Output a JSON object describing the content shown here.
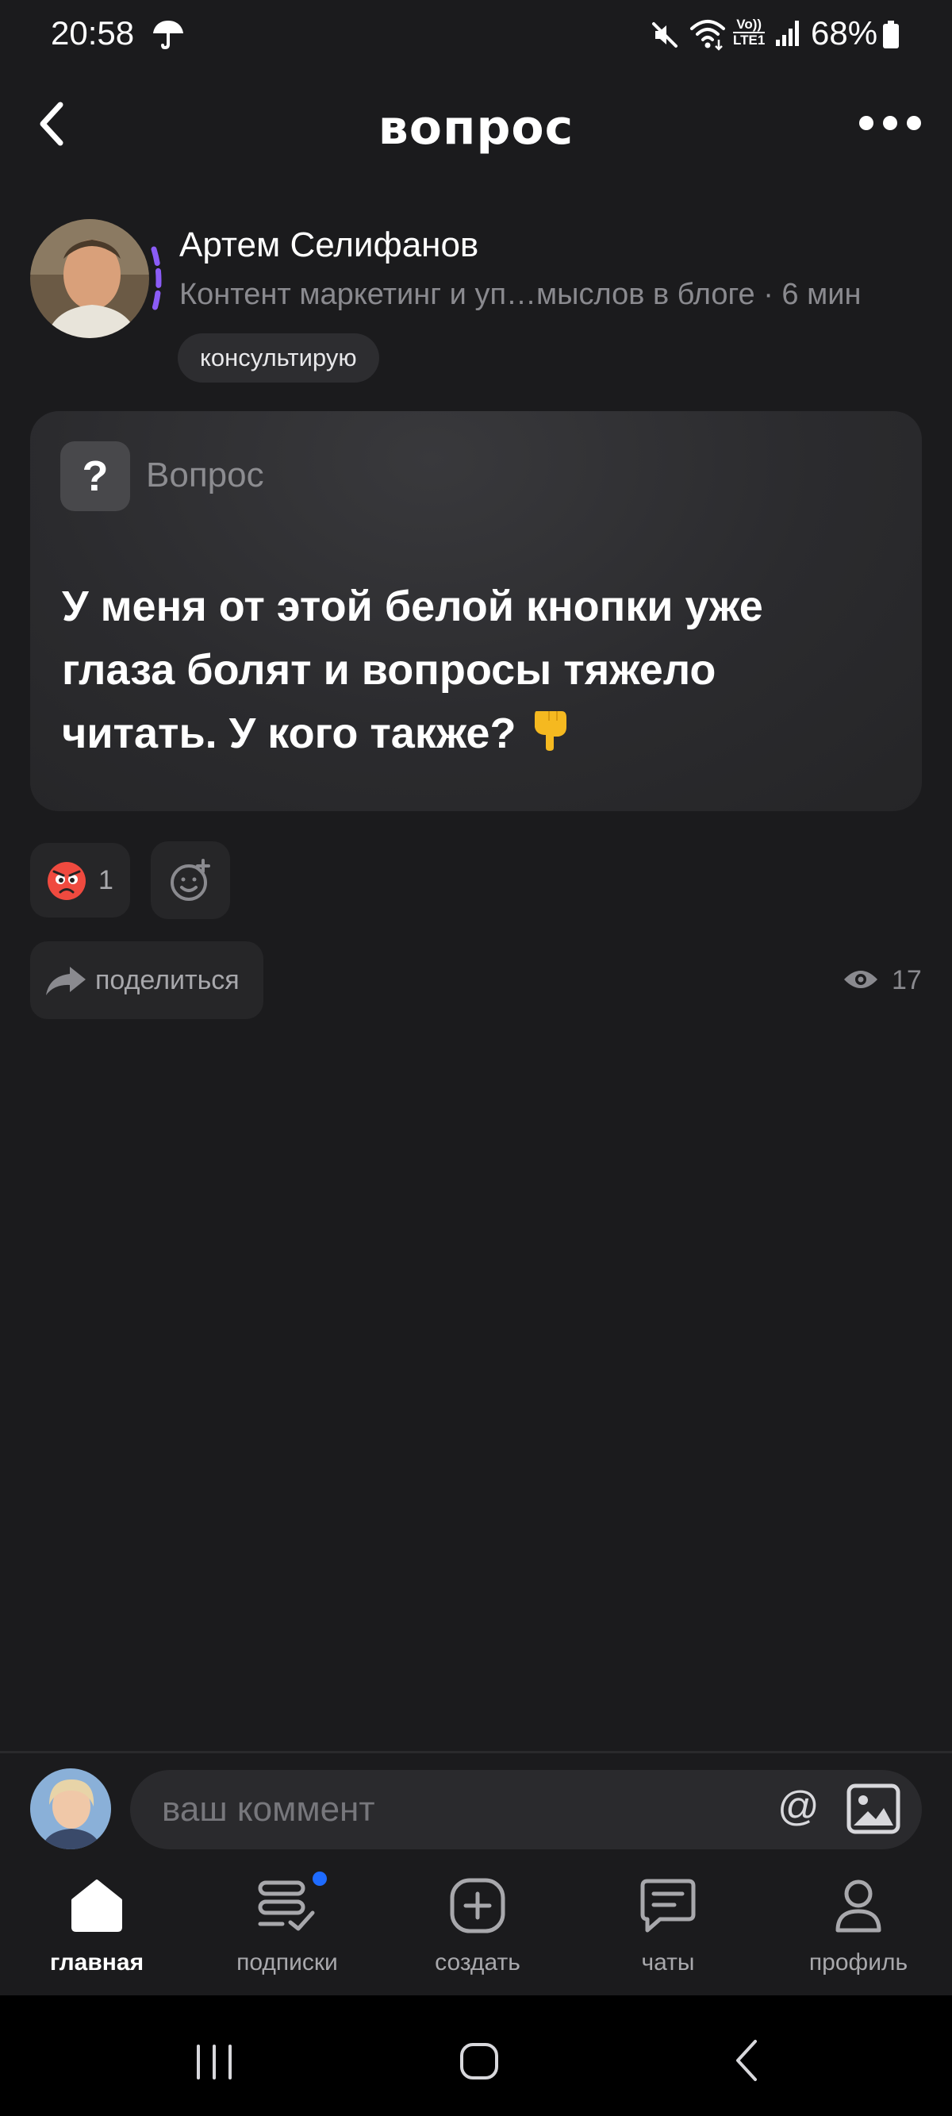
{
  "status_bar": {
    "time": "20:58",
    "volte_top": "Vo))",
    "volte_bottom": "LTE1",
    "battery": "68%",
    "icons": [
      "umbrella-icon",
      "mute-icon",
      "wifi-icon",
      "volte-icon",
      "signal-icon",
      "battery-icon"
    ]
  },
  "header": {
    "title": "вопрос",
    "back_icon": "chevron-left-icon",
    "more_icon": "more-dots-icon"
  },
  "author": {
    "name": "Артем Селифанов",
    "subtitle": "Контент маркетинг и уп…мыслов в блоге · 6 мин",
    "badge": "консультирую"
  },
  "post": {
    "type_label": "Вопрос",
    "type_icon_glyph": "?",
    "text": "У меня от этой белой кнопки уже глаза болят и вопросы тяжело читать. У кого также?",
    "emoji": "pointing-down-hand"
  },
  "reactions": {
    "count": "1",
    "emoji": "angry-face",
    "add_icon": "add-reaction-icon"
  },
  "share": {
    "label": "поделиться"
  },
  "views": {
    "count": "17"
  },
  "comment": {
    "placeholder": "ваш коммент",
    "mention_glyph": "@"
  },
  "nav": {
    "items": [
      {
        "label": "главная",
        "icon": "home-icon",
        "active": true
      },
      {
        "label": "подписки",
        "icon": "subscriptions-icon",
        "has_dot": true
      },
      {
        "label": "создать",
        "icon": "create-plus-icon"
      },
      {
        "label": "чаты",
        "icon": "chat-icon"
      },
      {
        "label": "профиль",
        "icon": "profile-icon"
      }
    ]
  },
  "colors": {
    "background": "#1b1b1d",
    "card": "#2b2b2e",
    "accent_ring": "#8b5cf6",
    "notification_dot": "#1e6bff"
  }
}
